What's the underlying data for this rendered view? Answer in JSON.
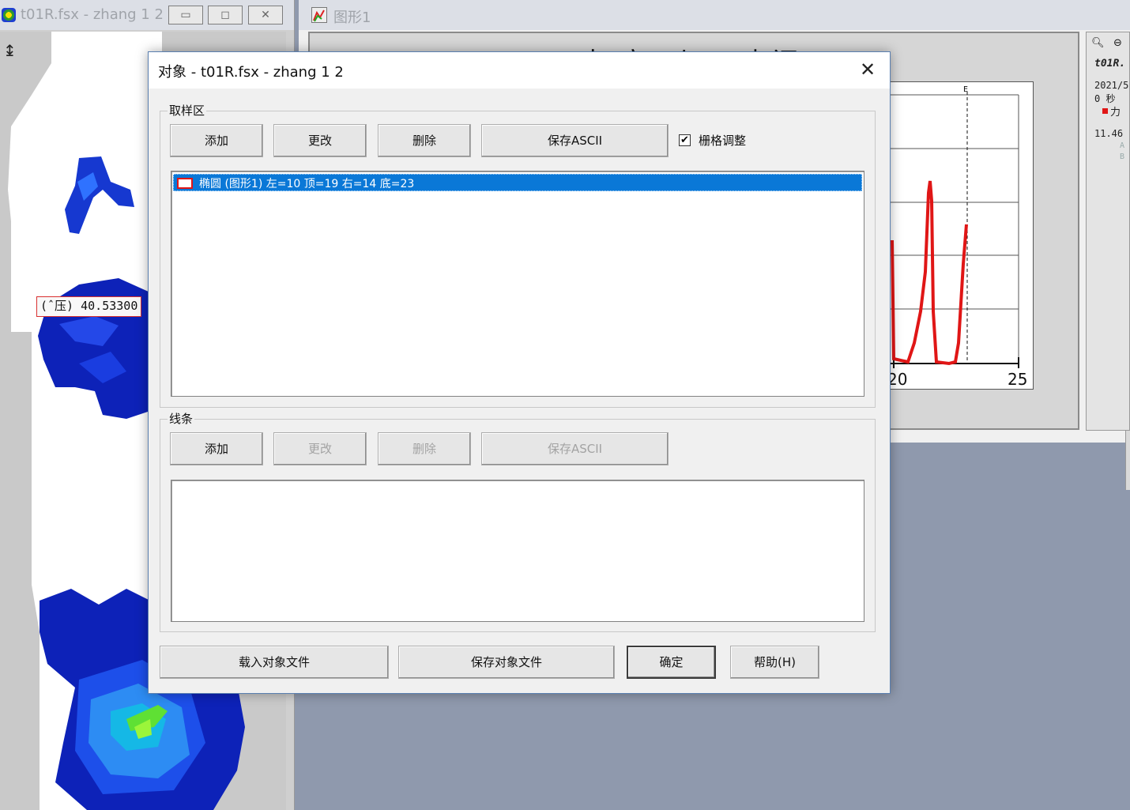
{
  "left_window": {
    "title": "t01R.fsx - zhang 1 2",
    "pressure_readout": "(ˆ压) 40.53300",
    "buttons": {
      "minimize": "▭",
      "restore": "◻",
      "close": "✕"
    }
  },
  "right_window": {
    "title": "图形1",
    "graph_title": "力度 与 时间",
    "plot": {
      "x_tick_labels": [
        "20",
        "25"
      ],
      "marker_label": "E"
    },
    "side_panel": {
      "title": "t01R.",
      "date": "2021/5",
      "time": "0 秒",
      "legend_label": "力",
      "value": "11.46",
      "faded_1": "A",
      "faded_2": "B"
    }
  },
  "dialog": {
    "title": "对象 - t01R.fsx - zhang 1 2",
    "close_glyph": "✕",
    "sample_group": {
      "label": "取样区",
      "add": "添加",
      "edit": "更改",
      "delete": "删除",
      "save_ascii": "保存ASCII",
      "grid_adjust_label": "栅格调整",
      "grid_adjust_checked": true,
      "items": [
        {
          "text": "椭圆 (图形1)  左=10  顶=19  右=14  底=23",
          "selected": true,
          "swatch_color": "#e01616"
        }
      ]
    },
    "line_group": {
      "label": "线条",
      "add": "添加",
      "edit": "更改",
      "delete": "删除",
      "save_ascii": "保存ASCII",
      "items": []
    },
    "footer": {
      "load": "载入对象文件",
      "save": "保存对象文件",
      "ok": "确定",
      "help": "帮助(H)"
    }
  },
  "colors": {
    "selection": "#0a78d7",
    "trace": "#e01616",
    "workspace": "#8f99ad"
  }
}
